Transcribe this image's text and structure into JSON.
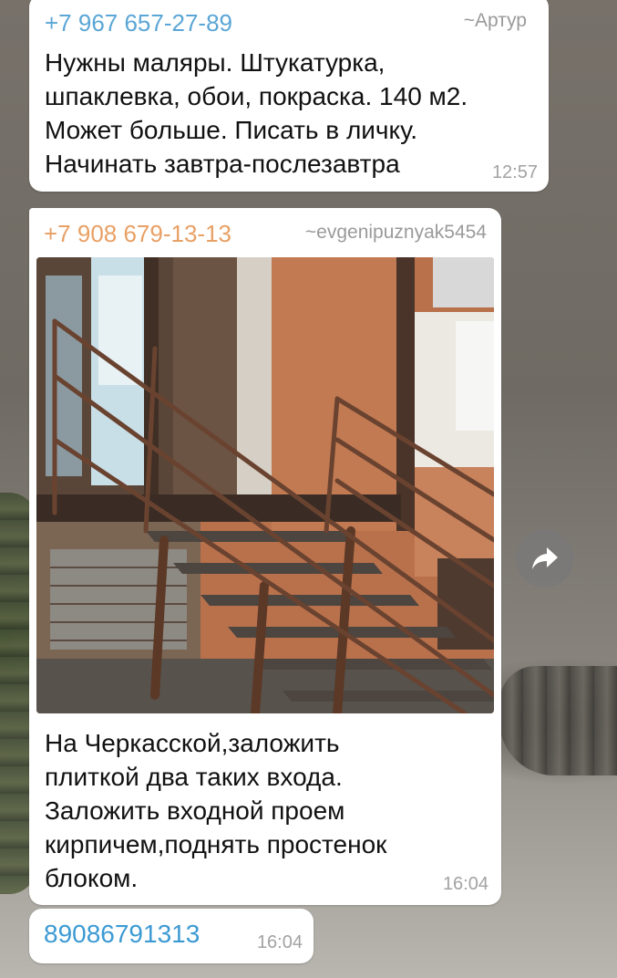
{
  "colors": {
    "sender1": "#5aa6d6",
    "sender2": "#e8a065",
    "link": "#3c9ad3",
    "bubble": "#ffffff",
    "time": "#a2a2a2"
  },
  "messages": [
    {
      "phone": "+7 967 657-27-89",
      "name": "~Артур",
      "lines": [
        "Нужны маляры. Штукатурка,",
        "шпаклевка, обои, покраска. 140 м2.",
        "Может больше. Писать в личку.",
        "Начинать завтра-послезавтра"
      ],
      "time": "12:57"
    },
    {
      "phone": "+7 908 679-13-13",
      "name": "~evgenipuznyak5454",
      "photo": "staircase-photo",
      "lines": [
        "На Черкасской,заложить",
        "плиткой два таких входа.",
        "Заложить входной проем",
        "кирпичем,поднять простенок",
        "блоком."
      ],
      "time": "16:04"
    },
    {
      "link": "89086791313",
      "time": "16:04"
    }
  ],
  "icons": {
    "share": "share-arrow-icon"
  }
}
